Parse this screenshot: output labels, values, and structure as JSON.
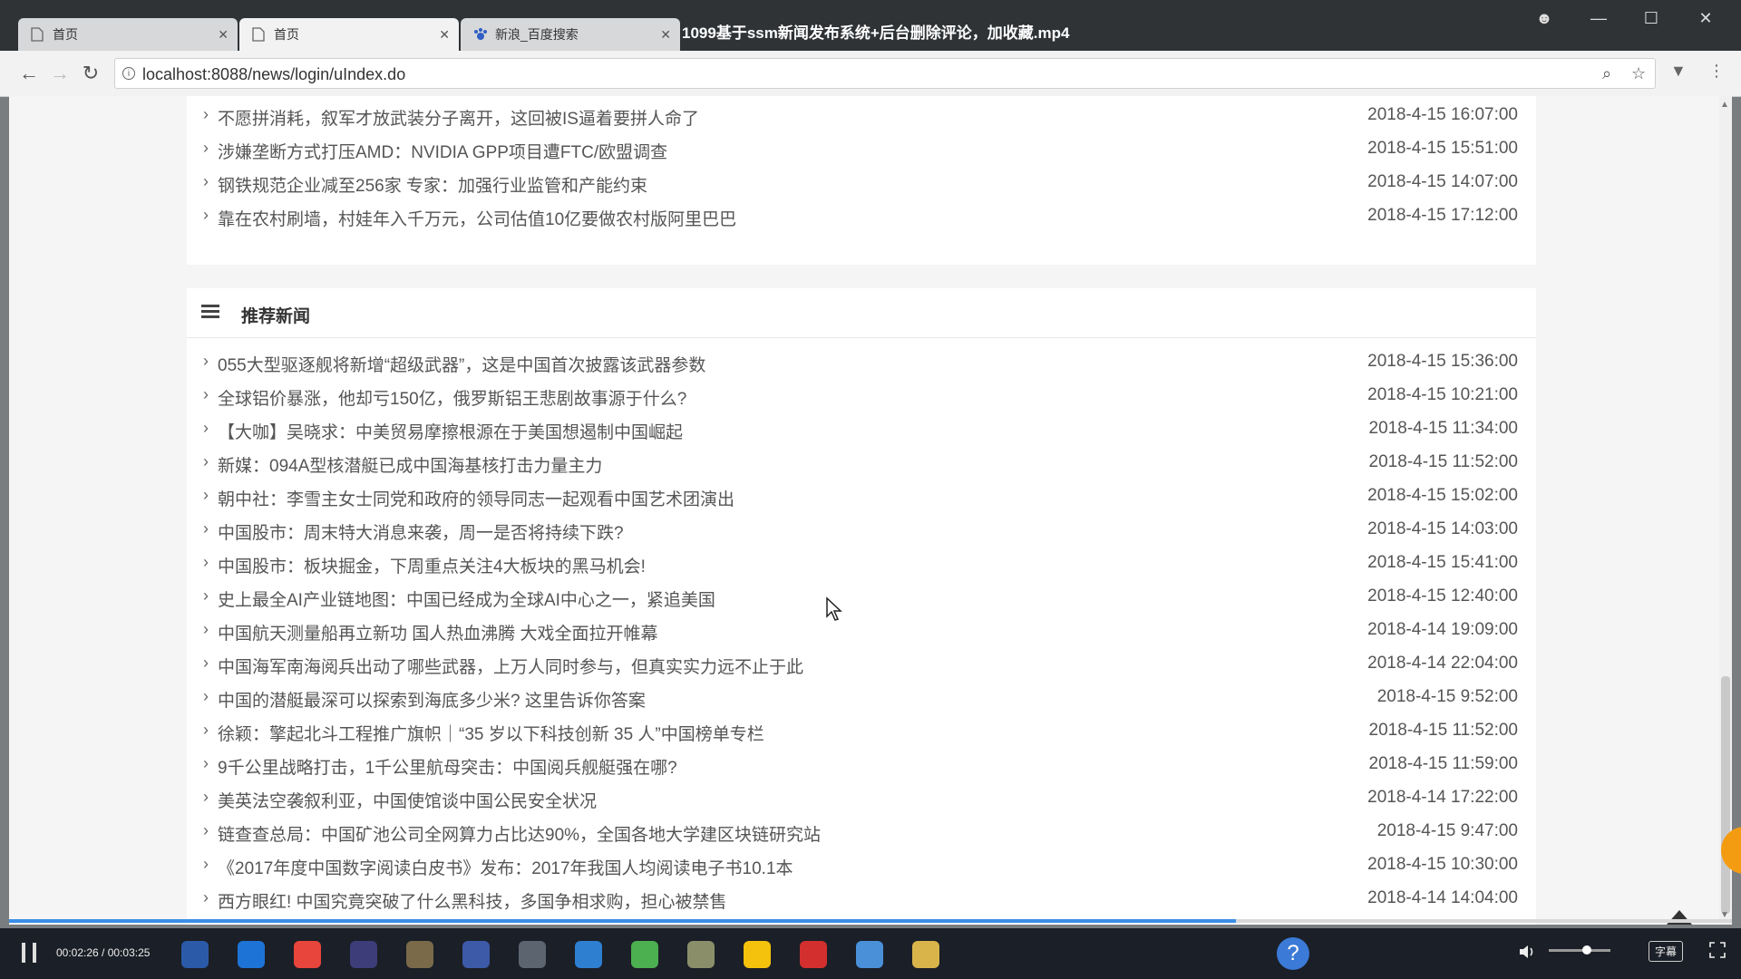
{
  "video": {
    "title": "1099基于ssm新闻发布系统+后台删除评论，加收藏.mp4",
    "time_display": "00:02:26 / 00:03:25",
    "progress_fraction": 0.712,
    "volume_fraction": 0.55,
    "subtitle_label": "字幕"
  },
  "browser": {
    "tabs": [
      {
        "label": "首页",
        "icon": "page-icon",
        "active": false
      },
      {
        "label": "首页",
        "icon": "page-icon",
        "active": true
      },
      {
        "label": "新浪_百度搜索",
        "icon": "baidu-paw-icon",
        "active": false
      }
    ],
    "url": "localhost:8088/news/login/uIndex.do",
    "icons": {
      "back": "←",
      "forward": "→",
      "reload": "↻",
      "zoom": "⌕",
      "star": "☆",
      "ext": "▼",
      "menu": "⋮",
      "close": "✕",
      "minimize": "—",
      "maximize": "☐",
      "profile": "☻"
    }
  },
  "page": {
    "top_list": [
      {
        "title": "不愿拼消耗，叙军才放武装分子离开，这回被IS逼着要拼人命了",
        "date": "2018-4-15 16:07:00"
      },
      {
        "title": "涉嫌垄断方式打压AMD：NVIDIA GPP项目遭FTC/欧盟调查",
        "date": "2018-4-15 15:51:00"
      },
      {
        "title": "钢铁规范企业减至256家 专家：加强行业监管和产能约束",
        "date": "2018-4-15 14:07:00"
      },
      {
        "title": "靠在农村刷墙，村娃年入千万元，公司估值10亿要做农村版阿里巴巴",
        "date": "2018-4-15 17:12:00"
      }
    ],
    "recommended": {
      "heading": "推荐新闻",
      "items": [
        {
          "title": "055大型驱逐舰将新增“超级武器”，这是中国首次披露该武器参数",
          "date": "2018-4-15 15:36:00"
        },
        {
          "title": "全球铝价暴涨，他却亏150亿，俄罗斯铝王悲剧故事源于什么?",
          "date": "2018-4-15 10:21:00"
        },
        {
          "title": "【大咖】吴晓求：中美贸易摩擦根源在于美国想遏制中国崛起",
          "date": "2018-4-15 11:34:00"
        },
        {
          "title": "新媒：094A型核潜艇已成中国海基核打击力量主力",
          "date": "2018-4-15 11:52:00"
        },
        {
          "title": "朝中社：李雪主女士同党和政府的领导同志一起观看中国艺术团演出",
          "date": "2018-4-15 15:02:00"
        },
        {
          "title": "中国股市：周末特大消息来袭，周一是否将持续下跌?",
          "date": "2018-4-15 14:03:00"
        },
        {
          "title": "中国股市：板块掘金，下周重点关注4大板块的黑马机会!",
          "date": "2018-4-15 15:41:00"
        },
        {
          "title": "史上最全AI产业链地图：中国已经成为全球AI中心之一，紧追美国",
          "date": "2018-4-15 12:40:00"
        },
        {
          "title": "中国航天测量船再立新功 国人热血沸腾 大戏全面拉开帷幕",
          "date": "2018-4-14 19:09:00"
        },
        {
          "title": "中国海军南海阅兵出动了哪些武器，上万人同时参与，但真实实力远不止于此",
          "date": "2018-4-14 22:04:00"
        },
        {
          "title": "中国的潜艇最深可以探索到海底多少米? 这里告诉你答案",
          "date": "2018-4-15 9:52:00"
        },
        {
          "title": "徐颖：擎起北斗工程推广旗帜｜“35 岁以下科技创新 35 人”中国榜单专栏",
          "date": "2018-4-15 11:52:00"
        },
        {
          "title": "9千公里战略打击，1千公里航母突击：中国阅兵舰艇强在哪?",
          "date": "2018-4-15 11:59:00"
        },
        {
          "title": "美英法空袭叙利亚，中国使馆谈中国公民安全状况",
          "date": "2018-4-14 17:22:00"
        },
        {
          "title": "链查查总局：中国矿池公司全网算力占比达90%，全国各地大学建区块链研究站",
          "date": "2018-4-15 9:47:00"
        },
        {
          "title": "《2017年度中国数字阅读白皮书》发布：2017年我国人均阅读电子书10.1本",
          "date": "2018-4-15 10:30:00"
        },
        {
          "title": "西方眼红! 中国究竟突破了什么黑科技，多国争相求购，担心被禁售",
          "date": "2018-4-14 14:04:00"
        }
      ]
    },
    "chevron": "›",
    "back_to_top": "🡅"
  },
  "taskbar": {
    "help_glyph": "?",
    "apps": [
      "sogou-icon",
      "edge-icon",
      "chrome-icon",
      "eclipse-icon",
      "file-icon",
      "settings-icon",
      "mail-icon",
      "kugou-icon",
      "leaf-icon",
      "disk-icon",
      "qq-icon",
      "pdf-icon",
      "network-icon",
      "folder-icon"
    ],
    "app_colors": [
      "#2b5aa8",
      "#1e73d6",
      "#e8453c",
      "#3d3d7a",
      "#7a6a4a",
      "#3c5aa8",
      "#5c6470",
      "#2e7fd0",
      "#4caf50",
      "#8a8f6a",
      "#f4c20d",
      "#d32f2f",
      "#4a90d9",
      "#d8b44a"
    ]
  }
}
